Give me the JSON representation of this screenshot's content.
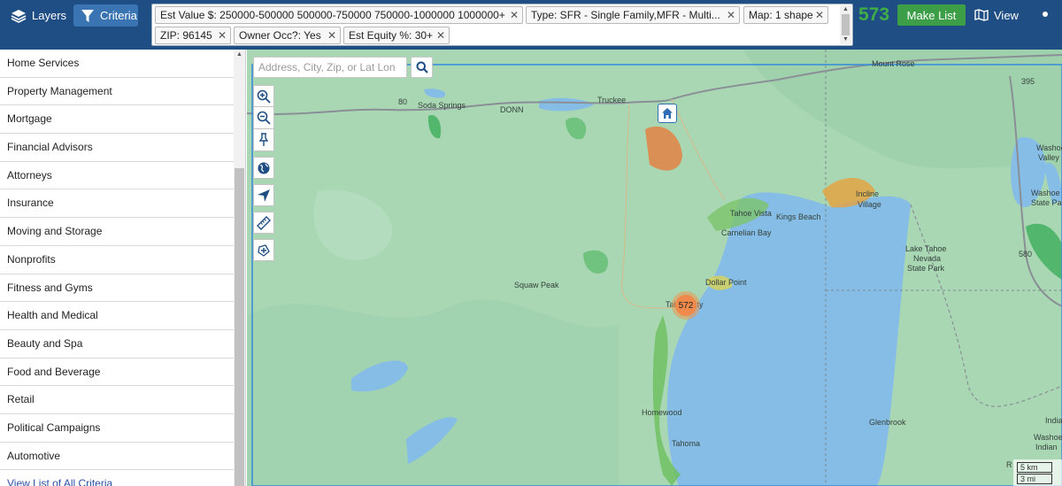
{
  "topbar": {
    "layers_label": "Layers",
    "criteria_label": "Criteria",
    "count": "573",
    "make_list_label": "Make List",
    "view_label": "View",
    "colors": {
      "bar": "#1f4e84",
      "active": "#3a74b3",
      "count": "#3fae49",
      "make_list": "#3c9f47"
    }
  },
  "chips": [
    {
      "label": "Est Value $: 250000-500000 500000-750000 750000-1000000 1000000+"
    },
    {
      "label": "Type: SFR - Single Family,MFR - Multi..."
    },
    {
      "label": "Map: 1 shape"
    },
    {
      "label": "ZIP: 96145"
    },
    {
      "label": "Owner Occ?: Yes"
    },
    {
      "label": "Est Equity %: 30+"
    }
  ],
  "chip_close": "✕",
  "sidebar": {
    "items": [
      "Home Services",
      "Property Management",
      "Mortgage",
      "Financial Advisors",
      "Attorneys",
      "Insurance",
      "Moving and Storage",
      "Nonprofits",
      "Fitness and Gyms",
      "Health and Medical",
      "Beauty and Spa",
      "Food and Beverage",
      "Retail",
      "Political Campaigns",
      "Automotive"
    ],
    "view_all_link": "View List of All Criteria"
  },
  "map": {
    "search_placeholder": "Address, City, Zip, or Lat Lon",
    "cluster_count": "572",
    "labels": {
      "soda_springs": "Soda Springs",
      "donner": "DONN",
      "truckee": "Truckee",
      "mount_rose": "Mount Rose",
      "tahoe_vista": "Tahoe Vista",
      "kings_beach": "Kings Beach",
      "incline": "Incline",
      "village": "Village",
      "carnelian_bay": "Carnelian Bay",
      "squaw_peak": "Squaw Peak",
      "dollar_point": "Dollar Point",
      "tahoe_city": "Tahoe City",
      "homewood": "Homewood",
      "tahoma": "Tahoma",
      "glenbrook": "Glenbrook",
      "washoe_valley_1": "Washoe",
      "washoe_valley_2": "Valley",
      "washoe_lake_1": "Washoe Lake",
      "washoe_lake_2": "State Park",
      "lake_tahoe_nv_1": "Lake Tahoe",
      "lake_tahoe_nv_2": "Nevada",
      "lake_tahoe_nv_3": "State Park",
      "washoe_indian_1": "Washoe",
      "washoe_indian_2": "Indian",
      "indian": "India",
      "highway_80": "80",
      "highway_395": "395",
      "highway_580": "580",
      "right_edge": "R"
    },
    "scale_km": "5 km",
    "scale_mi": "3 mi",
    "colors": {
      "land": "#a9d7b4",
      "water": "#86bde6",
      "boundary": "#3a8fd6"
    }
  }
}
